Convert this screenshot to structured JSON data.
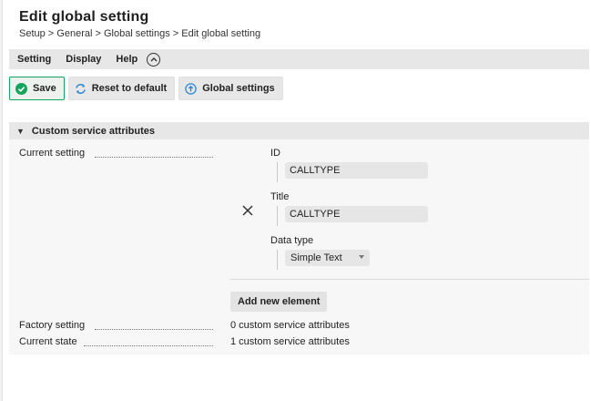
{
  "header": {
    "title": "Edit global setting",
    "breadcrumb": "Setup > General > Global settings > Edit global setting"
  },
  "menu": {
    "items": [
      "Setting",
      "Display",
      "Help"
    ]
  },
  "toolbar": {
    "save_label": "Save",
    "reset_label": "Reset to default",
    "global_label": "Global settings"
  },
  "section": {
    "title": "Custom service attributes"
  },
  "rows": {
    "current_setting_label": "Current setting",
    "factory_setting_label": "Factory setting",
    "factory_setting_value": "0 custom service attributes",
    "current_state_label": "Current state",
    "current_state_value": "1 custom service attributes"
  },
  "element": {
    "id_label": "ID",
    "id_value": "CALLTYPE",
    "title_label": "Title",
    "title_value": "CALLTYPE",
    "datatype_label": "Data type",
    "datatype_value": "Simple Text"
  },
  "add_button_label": "Add new element",
  "colors": {
    "save_accent": "#13a55c",
    "reset_icon": "#2f86d6",
    "global_icon": "#2f86d6"
  },
  "icons": {
    "save": "check-circle-icon",
    "reset": "refresh-arrows-icon",
    "global": "circle-arrow-up-icon",
    "collapse": "chevron-up-circle-icon",
    "remove": "close-icon",
    "section_toggle": "triangle-down-icon"
  }
}
